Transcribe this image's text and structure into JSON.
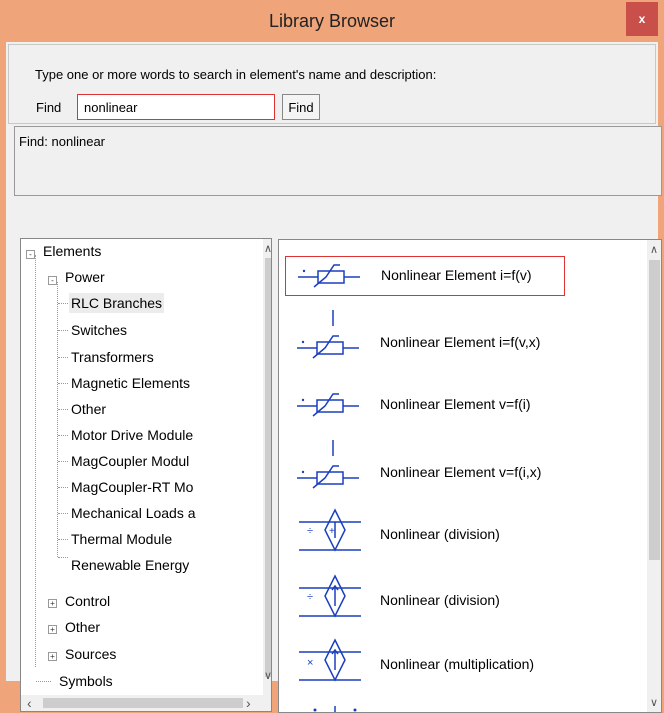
{
  "window": {
    "title": "Library Browser",
    "close_label": "x"
  },
  "search": {
    "instruction": "Type one or more words to search in element's name and  description:",
    "find_label": "Find",
    "query": "nonlinear",
    "find_button": "Find"
  },
  "results": {
    "status": "Find: nonlinear"
  },
  "tree": {
    "items": [
      {
        "label": "Elements",
        "expander": "-"
      },
      {
        "label": "Power",
        "expander": "-"
      },
      {
        "label": "RLC Branches",
        "selected": true
      },
      {
        "label": "Switches"
      },
      {
        "label": "Transformers"
      },
      {
        "label": "Magnetic Elements"
      },
      {
        "label": "Other"
      },
      {
        "label": "Motor Drive Module"
      },
      {
        "label": "MagCoupler Modul"
      },
      {
        "label": "MagCoupler-RT Mo"
      },
      {
        "label": "Mechanical Loads a"
      },
      {
        "label": "Thermal Module"
      },
      {
        "label": "Renewable Energy"
      },
      {
        "label": "Control",
        "expander": "+"
      },
      {
        "label": "Other",
        "expander": "+"
      },
      {
        "label": "Sources",
        "expander": "+"
      },
      {
        "label": "Symbols"
      }
    ]
  },
  "list": {
    "items": [
      {
        "label": "Nonlinear Element i=f(v)",
        "selected": true,
        "icon": "nonlinear-resistor-icon"
      },
      {
        "label": "Nonlinear Element i=f(v,x)",
        "icon": "nonlinear-resistor-control-icon"
      },
      {
        "label": "Nonlinear Element v=f(i)",
        "icon": "nonlinear-resistor-icon"
      },
      {
        "label": "Nonlinear Element v=f(i,x)",
        "icon": "nonlinear-resistor-control-icon"
      },
      {
        "label": "Nonlinear (division)",
        "icon": "dependent-source-division-icon"
      },
      {
        "label": "Nonlinear (division)",
        "icon": "dependent-source-division-icon"
      },
      {
        "label": "Nonlinear (multiplication)",
        "icon": "dependent-source-multiplication-icon"
      }
    ]
  },
  "colors": {
    "window_frame": "#efa47a",
    "close_button": "#c9504a",
    "highlight_border": "#dd3333",
    "icon_blue": "#1a3fbf"
  }
}
